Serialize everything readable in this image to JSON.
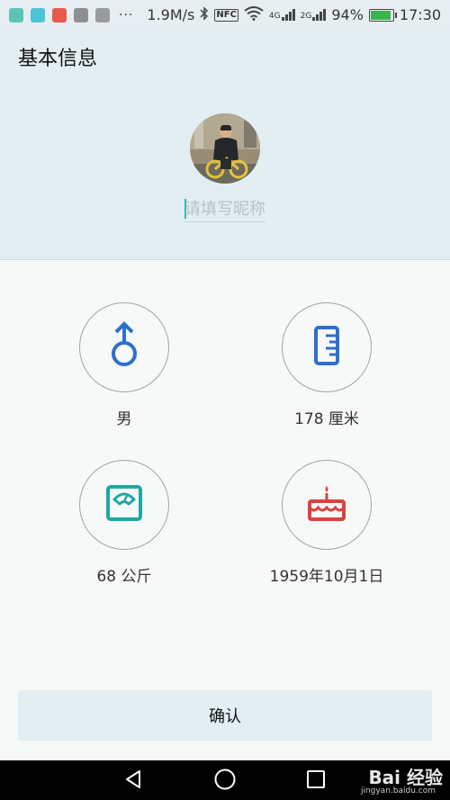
{
  "status_bar": {
    "speed": "1.9M/s",
    "nfc": "NFC",
    "net_4g": "4G",
    "net_2g": "2G",
    "battery": "94%",
    "battery_level": 0.94,
    "time": "17:30",
    "more": "···"
  },
  "header": {
    "title": "基本信息",
    "nickname_placeholder": "请填写昵称",
    "nickname_value": ""
  },
  "options": {
    "gender": {
      "label": "男",
      "icon": "male-icon",
      "color": "#2d6fd0"
    },
    "height": {
      "label": "178 厘米",
      "icon": "ruler-icon",
      "color": "#2d6fd0"
    },
    "weight": {
      "label": "68 公斤",
      "icon": "scale-icon",
      "color": "#1fa8a5"
    },
    "birthday": {
      "label": "1959年10月1日",
      "icon": "cake-icon",
      "color": "#d9433f"
    }
  },
  "confirm": {
    "label": "确认"
  },
  "watermark": {
    "text": "Bai 经验",
    "sub": "jingyan.baidu.com"
  },
  "colors": {
    "accent": "#3cb3a8",
    "header_bg": "#e3eef2",
    "nav_bg": "#000000"
  }
}
